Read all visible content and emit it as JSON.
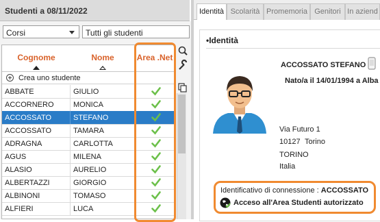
{
  "left_panel": {
    "title": "Studenti a 08/11/2022",
    "dropdown_left": "Corsi",
    "dropdown_right": "Tutti gli studenti",
    "columns": {
      "surname": "Cognome",
      "name": "Nome",
      "area_net": "Area .Net"
    },
    "create_label": "Crea uno studente",
    "rows": [
      {
        "surname": "ABBATE",
        "name": "GIULIO",
        "area_net": true,
        "selected": false
      },
      {
        "surname": "ACCORNERO",
        "name": "MONICA",
        "area_net": true,
        "selected": false
      },
      {
        "surname": "ACCOSSATO",
        "name": "STEFANO",
        "area_net": true,
        "selected": true
      },
      {
        "surname": "ACCOSSATO",
        "name": "TAMARA",
        "area_net": true,
        "selected": false
      },
      {
        "surname": "ADRAGNA",
        "name": "CARLOTTA",
        "area_net": true,
        "selected": false
      },
      {
        "surname": "AGUS",
        "name": "MILENA",
        "area_net": true,
        "selected": false
      },
      {
        "surname": "ALASIO",
        "name": "AURELIO",
        "area_net": true,
        "selected": false
      },
      {
        "surname": "ALBERTAZZI",
        "name": "GIORGIO",
        "area_net": true,
        "selected": false
      },
      {
        "surname": "ALBINONI",
        "name": "TOMASO",
        "area_net": true,
        "selected": false
      },
      {
        "surname": "ALFIERI",
        "name": "LUCA",
        "area_net": true,
        "selected": false
      }
    ]
  },
  "tabs": [
    "Identità",
    "Scolarità",
    "Promemoria",
    "Genitori",
    "In aziend"
  ],
  "identity": {
    "section_title": "•Identità",
    "student_name": "ACCOSSATO STEFANO",
    "birth_line": "Nato/a il 14/01/1994 a Alba -",
    "address_street": "Via Futuro 1",
    "address_cap": "10127",
    "address_city_small": "Torino",
    "address_city": "TORINO",
    "address_country": "Italia",
    "connection_label": "Identificativo di connessione :",
    "connection_id": "ACCOSSATO",
    "access_text": "Acceso all'Area Studenti autorizzato"
  },
  "colors": {
    "accent_orange": "#f08a30",
    "header_orange": "#d9622a",
    "selection_blue": "#2a7cc7",
    "check_green": "#6cc04a"
  }
}
